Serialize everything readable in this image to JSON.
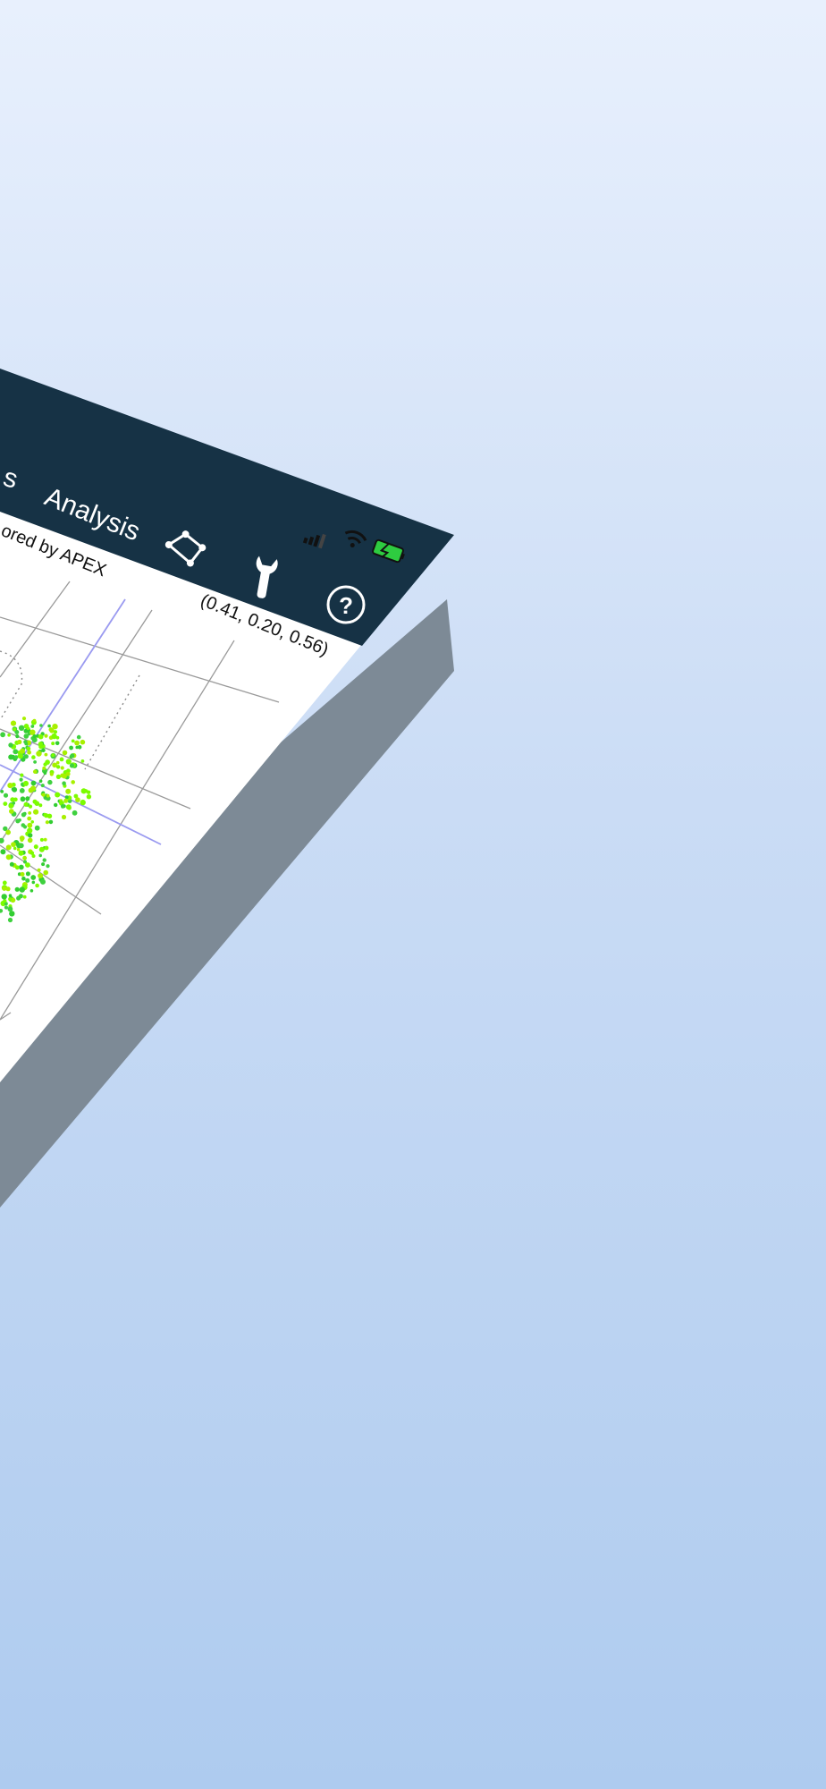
{
  "nav": {
    "prev_tab_fragment": "s",
    "analysis_tab": "Analysis",
    "subtitle_fragment": "ored by APEX"
  },
  "toolbar": {
    "polygon_icon": "polygon-select-icon",
    "wrench_icon": "wrench-icon",
    "help_icon": "help-icon",
    "help_label": "?"
  },
  "status_bar": {
    "signal_icon": "cellular-signal-icon",
    "wifi_icon": "wifi-icon",
    "battery_icon": "battery-charging-icon",
    "battery_color": "#2ecc40"
  },
  "plot": {
    "cursor_readout": "(0.41, 0.20, 0.56)",
    "point_colors": [
      "#7cfc00",
      "#32cd32",
      "#a8f000",
      "#3fd13f"
    ]
  },
  "colors": {
    "header": "#163245",
    "screen": "#ffffff",
    "shadow": "#7d8a96",
    "background_top": "#e8f0fd",
    "background_bottom": "#aecbef"
  }
}
